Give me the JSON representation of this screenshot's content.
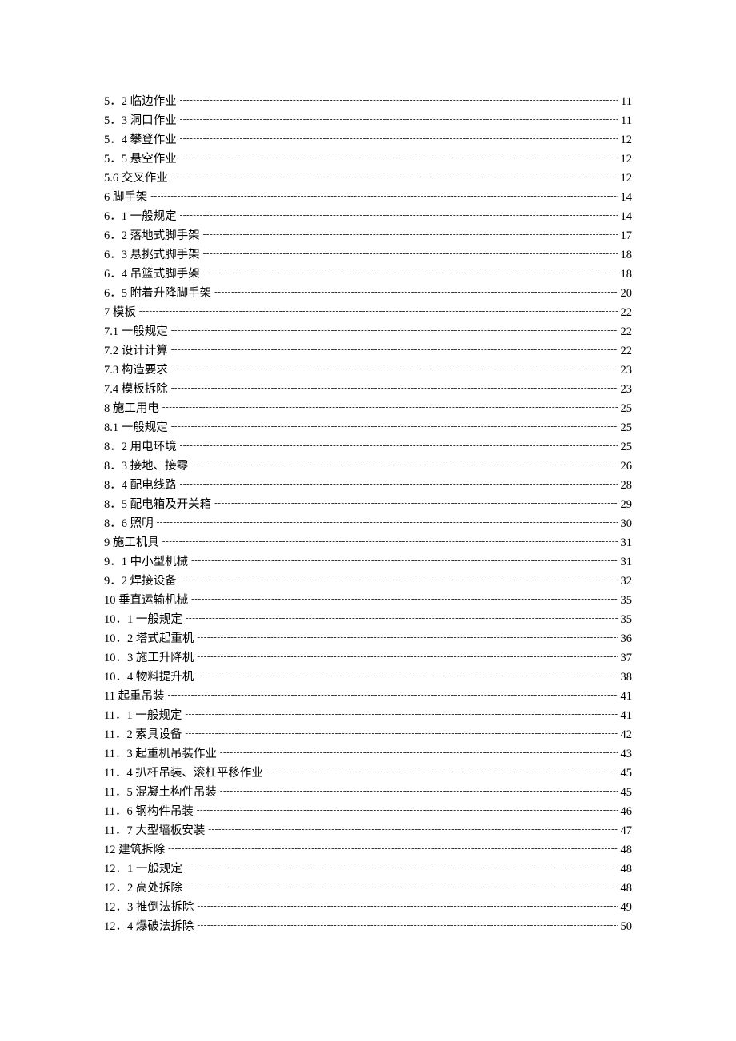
{
  "toc": [
    {
      "label": "5．2 临边作业",
      "page": "11"
    },
    {
      "label": "5．3 洞口作业",
      "page": "11"
    },
    {
      "label": "5．4 攀登作业",
      "page": "12"
    },
    {
      "label": "5．5 悬空作业",
      "page": "12"
    },
    {
      "label": "5.6 交叉作业",
      "page": "12"
    },
    {
      "label": "6 脚手架",
      "page": "14"
    },
    {
      "label": "6．1 一般规定",
      "page": "14"
    },
    {
      "label": "6．2 落地式脚手架",
      "page": "17"
    },
    {
      "label": "6．3 悬挑式脚手架",
      "page": "18"
    },
    {
      "label": "6．4 吊篮式脚手架",
      "page": "18"
    },
    {
      "label": "6．5 附着升降脚手架",
      "page": "20"
    },
    {
      "label": "7 模板",
      "page": "22"
    },
    {
      "label": "7.1 一般规定",
      "page": "22"
    },
    {
      "label": "7.2 设计计算",
      "page": "22"
    },
    {
      "label": "7.3 构造要求",
      "page": "23"
    },
    {
      "label": "7.4 模板拆除",
      "page": "23"
    },
    {
      "label": "8 施工用电",
      "page": "25"
    },
    {
      "label": "8.1 一般规定",
      "page": "25"
    },
    {
      "label": "8．2 用电环境",
      "page": "25"
    },
    {
      "label": "8．3 接地、接零",
      "page": "26"
    },
    {
      "label": "8．4 配电线路",
      "page": "28"
    },
    {
      "label": "8．5 配电箱及开关箱",
      "page": "29"
    },
    {
      "label": "8．6 照明",
      "page": "30"
    },
    {
      "label": "9 施工机具",
      "page": "31"
    },
    {
      "label": "9．1 中小型机械",
      "page": "31"
    },
    {
      "label": "9．2 焊接设备",
      "page": "32"
    },
    {
      "label": "10 垂直运输机械",
      "page": "35"
    },
    {
      "label": "10．1 一般规定",
      "page": "35"
    },
    {
      "label": "10．2 塔式起重机",
      "page": "36"
    },
    {
      "label": "10．3 施工升降机",
      "page": "37"
    },
    {
      "label": "10．4 物料提升机",
      "page": "38"
    },
    {
      "label": "11 起重吊装",
      "page": "41"
    },
    {
      "label": "11．1 一般规定",
      "page": "41"
    },
    {
      "label": "11．2 索具设备",
      "page": "42"
    },
    {
      "label": "11．3 起重机吊装作业",
      "page": "43"
    },
    {
      "label": "11．4 扒杆吊装、滚杠平移作业",
      "page": "45"
    },
    {
      "label": "11．5 混凝土构件吊装",
      "page": "45"
    },
    {
      "label": "11．6 钢构件吊装",
      "page": "46"
    },
    {
      "label": "11．7 大型墙板安装",
      "page": "47"
    },
    {
      "label": "12 建筑拆除",
      "page": "48"
    },
    {
      "label": "12．1 一般规定",
      "page": "48"
    },
    {
      "label": "12．2 高处拆除",
      "page": "48"
    },
    {
      "label": "12．3 推倒法拆除",
      "page": "49"
    },
    {
      "label": "12．4 爆破法拆除",
      "page": "50"
    }
  ]
}
